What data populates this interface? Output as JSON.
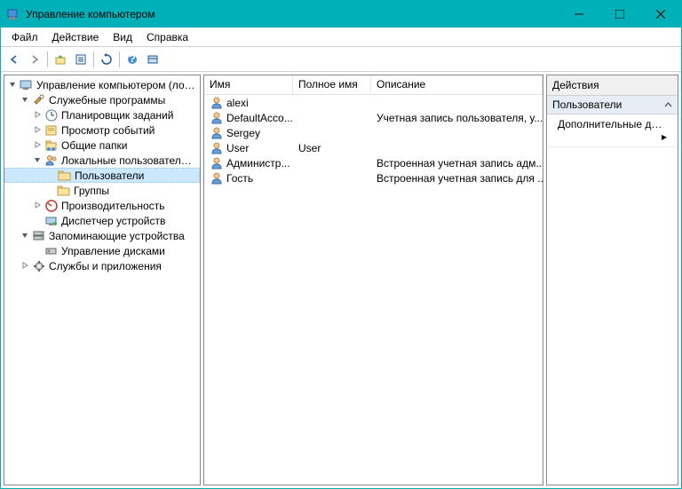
{
  "window": {
    "title": "Управление компьютером"
  },
  "menus": {
    "file": "Файл",
    "action": "Действие",
    "view": "Вид",
    "help": "Справка"
  },
  "tree": {
    "root": "Управление компьютером (локальным)",
    "system_tools": "Служебные программы",
    "task_scheduler": "Планировщик заданий",
    "event_viewer": "Просмотр событий",
    "shared_folders": "Общие папки",
    "local_users_groups": "Локальные пользователи и группы",
    "users": "Пользователи",
    "groups": "Группы",
    "performance": "Производительность",
    "device_manager": "Диспетчер устройств",
    "storage": "Запоминающие устройства",
    "disk_management": "Управление дисками",
    "services_apps": "Службы и приложения"
  },
  "list": {
    "columns": {
      "name": "Имя",
      "fullname": "Полное имя",
      "description": "Описание"
    },
    "rows": [
      {
        "name": "alexi",
        "fullname": "",
        "description": ""
      },
      {
        "name": "DefaultAcco...",
        "fullname": "",
        "description": "Учетная запись пользователя, у..."
      },
      {
        "name": "Sergey",
        "fullname": "",
        "description": ""
      },
      {
        "name": "User",
        "fullname": "User",
        "description": ""
      },
      {
        "name": "Администр...",
        "fullname": "",
        "description": "Встроенная учетная запись адм..."
      },
      {
        "name": "Гость",
        "fullname": "",
        "description": "Встроенная учетная запись для ..."
      }
    ]
  },
  "actions": {
    "header": "Действия",
    "section": "Пользователи",
    "more": "Дополнительные дей..."
  }
}
